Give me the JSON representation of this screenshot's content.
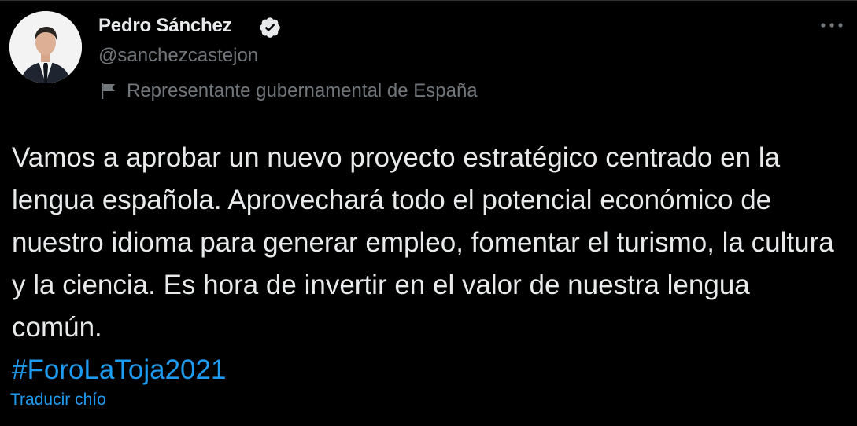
{
  "author": {
    "display_name": "Pedro Sánchez",
    "handle": "@sanchezcastejon",
    "verified_icon": "verified-badge-icon",
    "label_icon": "flag-icon",
    "label_text": "Representante gubernamental de España"
  },
  "menu": {
    "icon": "more-options-icon"
  },
  "tweet": {
    "text": "Vamos a aprobar un nuevo proyecto estratégico centrado en la lengua española. Aprovechará todo el potencial económico de nuestro idioma para generar empleo, fomentar el turismo, la cultura y la ciencia. Es hora de invertir en el valor de nuestra lengua común.",
    "hashtag": "#ForoLaToja2021",
    "translate_link": "Traducir chío"
  },
  "colors": {
    "background": "#000000",
    "text_primary": "#e7e9ea",
    "text_secondary": "#71767b",
    "link": "#1d9bf0"
  }
}
